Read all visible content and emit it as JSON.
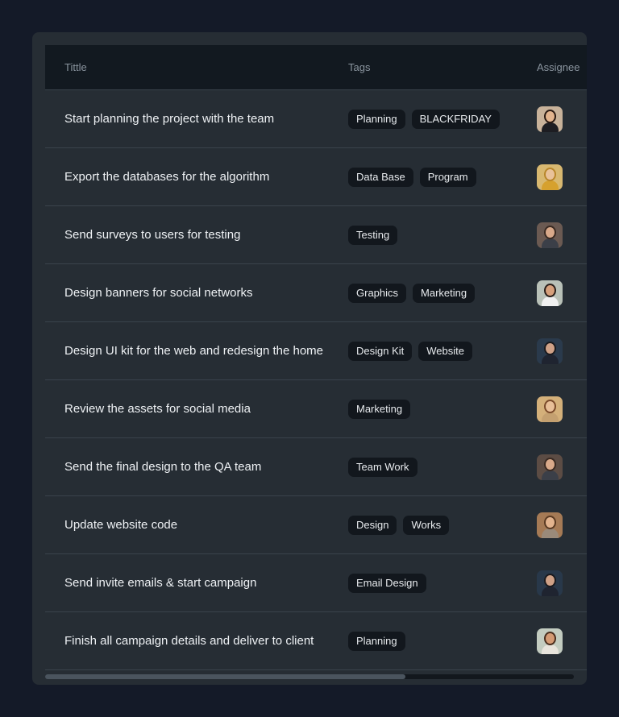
{
  "table": {
    "headers": {
      "title": "Tittle",
      "tags": "Tags",
      "assignee": "Assignee"
    },
    "rows": [
      {
        "title": "Start planning the project with the team",
        "tags": [
          "Planning",
          "BLACKFRIDAY"
        ],
        "avatar": {
          "bg": "#c8b29a",
          "skin": "#e3b48e",
          "hair": "#2b1a12",
          "shirt": "#1d1d22"
        }
      },
      {
        "title": "Export the databases for the algorithm",
        "tags": [
          "Data Base",
          "Program"
        ],
        "avatar": {
          "bg": "#d8b870",
          "skin": "#e9c29a",
          "hair": "#b8862a",
          "shirt": "#d6a12e"
        }
      },
      {
        "title": "Send surveys to users for testing",
        "tags": [
          "Testing"
        ],
        "avatar": {
          "bg": "#6b5a52",
          "skin": "#d9a98a",
          "hair": "#3a2a22",
          "shirt": "#3b3f48"
        }
      },
      {
        "title": "Design banners for social networks",
        "tags": [
          "Graphics",
          "Marketing"
        ],
        "avatar": {
          "bg": "#b9c1b8",
          "skin": "#d7a07c",
          "hair": "#2a1f1a",
          "shirt": "#f0f0f0"
        }
      },
      {
        "title": "Design UI kit for the web and redesign the home",
        "tags": [
          "Design Kit",
          "Website"
        ],
        "avatar": {
          "bg": "#2a3a4c",
          "skin": "#cfa187",
          "hair": "#1a1a1e",
          "shirt": "#1f2430"
        }
      },
      {
        "title": "Review the assets for social media",
        "tags": [
          "Marketing"
        ],
        "avatar": {
          "bg": "#d4b07a",
          "skin": "#e8bf98",
          "hair": "#7a4a2a",
          "shirt": "#c4a070"
        }
      },
      {
        "title": "Send the final design to the QA team",
        "tags": [
          "Team Work"
        ],
        "avatar": {
          "bg": "#5c4c44",
          "skin": "#d9a98a",
          "hair": "#3a2a22",
          "shirt": "#3b3f48"
        }
      },
      {
        "title": "Update website code",
        "tags": [
          "Design",
          "Works"
        ],
        "avatar": {
          "bg": "#a57a55",
          "skin": "#e3b48e",
          "hair": "#5a3a22",
          "shirt": "#9a8a7a"
        }
      },
      {
        "title": "Send invite emails & start campaign",
        "tags": [
          "Email Design"
        ],
        "avatar": {
          "bg": "#28384a",
          "skin": "#cfa187",
          "hair": "#1a1a1e",
          "shirt": "#1f2430"
        }
      },
      {
        "title": "Finish all campaign details and deliver to client",
        "tags": [
          "Planning"
        ],
        "avatar": {
          "bg": "#c3ccc0",
          "skin": "#d49a74",
          "hair": "#4a2e1e",
          "shirt": "#e8e4dc"
        }
      }
    ]
  }
}
